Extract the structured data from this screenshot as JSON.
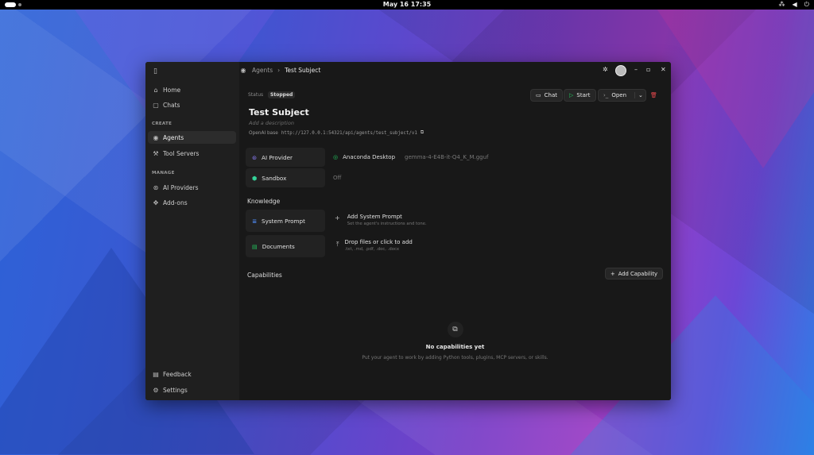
{
  "system_bar": {
    "clock": "May 16  17:35",
    "tray_icons": [
      "network-icon",
      "volume-icon",
      "power-icon"
    ]
  },
  "sidebar": {
    "top_items": [
      {
        "label": "Home",
        "icon": "home-icon"
      },
      {
        "label": "Chats",
        "icon": "chat-icon"
      }
    ],
    "create_header": "CREATE",
    "create_items": [
      {
        "label": "Agents",
        "icon": "agent-icon",
        "active": true
      },
      {
        "label": "Tool Servers",
        "icon": "server-icon"
      }
    ],
    "manage_header": "MANAGE",
    "manage_items": [
      {
        "label": "AI Providers",
        "icon": "ai-icon"
      },
      {
        "label": "Add-ons",
        "icon": "puzzle-icon"
      }
    ],
    "bottom_items": [
      {
        "label": "Feedback",
        "icon": "feedback-icon"
      },
      {
        "label": "Settings",
        "icon": "gear-icon"
      }
    ]
  },
  "breadcrumb": {
    "parent": "Agents",
    "current": "Test Subject"
  },
  "agent": {
    "status_label": "Status",
    "status_value": "Stopped",
    "name": "Test Subject",
    "description_placeholder": "Add a description",
    "api_label": "OpenAI base",
    "api_url": "http://127.0.0.1:54321/api/agents/test_subject/v1"
  },
  "actions": {
    "chat": "Chat",
    "start": "Start",
    "open": "Open"
  },
  "config": {
    "ai_provider_label": "AI Provider",
    "ai_provider_value": "Anaconda Desktop",
    "model": "gemma-4-E4B-it-Q4_K_M.gguf",
    "sandbox_label": "Sandbox",
    "sandbox_value": "Off"
  },
  "knowledge": {
    "header": "Knowledge",
    "system_prompt_label": "System Prompt",
    "add_prompt_title": "Add System Prompt",
    "add_prompt_sub": "Set the agent's instructions and tone.",
    "documents_label": "Documents",
    "drop_title": "Drop files or click to add",
    "drop_sub": ".txt, .md, .pdf, .doc, .docx"
  },
  "capabilities": {
    "header": "Capabilities",
    "add_button": "Add Capability",
    "empty_title": "No capabilities yet",
    "empty_sub": "Put your agent to work by adding Python tools, plugins, MCP servers, or skills."
  },
  "colors": {
    "accent_green": "#22c55e",
    "danger": "#e5484d",
    "provider_purple": "#8b7cf6",
    "sandbox_green": "#34d399",
    "docs_blue": "#4f8cf7"
  }
}
